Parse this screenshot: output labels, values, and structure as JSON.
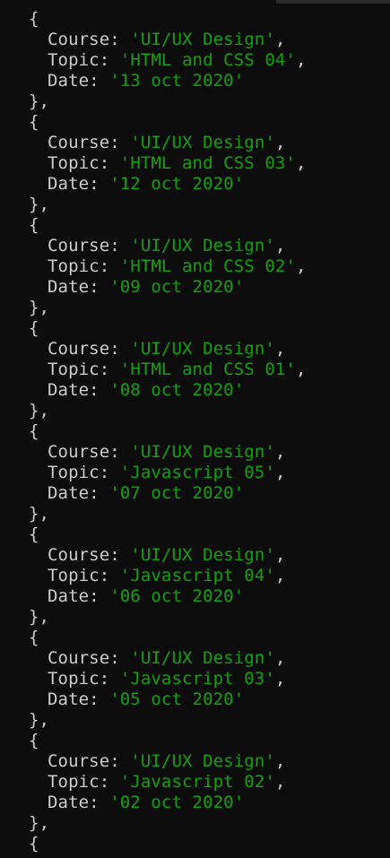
{
  "console": {
    "records": [
      {
        "course": "'UI/UX Design'",
        "topic": "'HTML and CSS 04'",
        "date": "'13 oct 2020'"
      },
      {
        "course": "'UI/UX Design'",
        "topic": "'HTML and CSS 03'",
        "date": "'12 oct 2020'"
      },
      {
        "course": "'UI/UX Design'",
        "topic": "'HTML and CSS 02'",
        "date": "'09 oct 2020'"
      },
      {
        "course": "'UI/UX Design'",
        "topic": "'HTML and CSS 01'",
        "date": "'08 oct 2020'"
      },
      {
        "course": "'UI/UX Design'",
        "topic": "'Javascript 05'",
        "date": "'07 oct 2020'"
      },
      {
        "course": "'UI/UX Design'",
        "topic": "'Javascript 04'",
        "date": "'06 oct 2020'"
      },
      {
        "course": "'UI/UX Design'",
        "topic": "'Javascript 03'",
        "date": "'05 oct 2020'"
      },
      {
        "course": "'UI/UX Design'",
        "topic": "'Javascript 02'",
        "date": "'02 oct 2020'"
      }
    ],
    "labels": {
      "open_brace": "{",
      "close_brace": "},",
      "course_key": "Course: ",
      "topic_key": "Topic: ",
      "date_key": "Date: ",
      "comma": ","
    },
    "colors": {
      "background": "#0c0c0c",
      "text": "#cccccc",
      "string": "#13a10e"
    }
  }
}
